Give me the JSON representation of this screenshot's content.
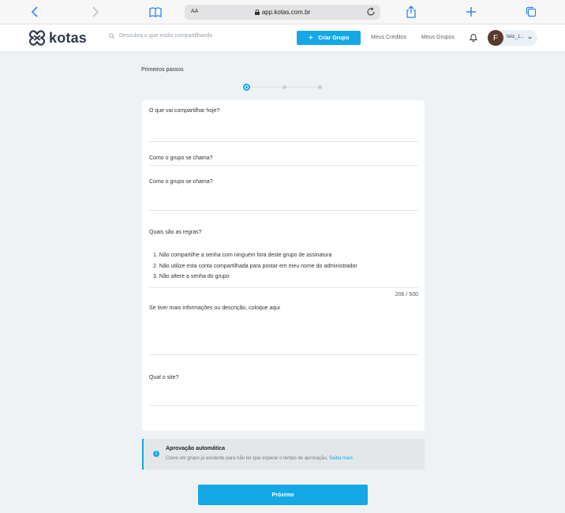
{
  "browser": {
    "text_size_label": "AA",
    "url": "app.kotas.com.br"
  },
  "header": {
    "logo_text": "kotas",
    "search_placeholder": "Descubra o que estão compartilhando",
    "create_group_label": "Criar Grupo",
    "nav": [
      "Meus Créditos",
      "Meus Grupos"
    ],
    "user_initial": "F",
    "user_name": "feliz_1..."
  },
  "steps": {
    "title": "Primeiros passos",
    "current": 1,
    "total": 3
  },
  "form": {
    "share_label": "O que vai compartilhar hoje?",
    "group_name_clipped": "Como o grupo se chama?",
    "group_name_label": "Como o grupo se chama?",
    "rules_label": "Quais são as regras?",
    "rules": [
      "1. Não compartilhe a senha com ninguém fora deste grupo de assinatura",
      "2. Não utilize esta conta compartilhada para postar em meu nome do administrador",
      "3. Não altere a senha do grupo"
    ],
    "rules_counter": "206 / 500",
    "description_label": "Se tiver mais informações ou descrição, coloque aqui",
    "site_label": "Qual o site?"
  },
  "info": {
    "icon": "info-icon",
    "title": "Aprovação automática",
    "text": "Clone um grupo já existente para não ter que esperar o tempo de aprovação.",
    "link": "Saiba mais"
  },
  "next_label": "Próximo",
  "colors": {
    "accent": "#14a9e6",
    "background": "#eef2f4",
    "logo": "#2f3a4c",
    "browser_icons": "#2f86f6"
  }
}
